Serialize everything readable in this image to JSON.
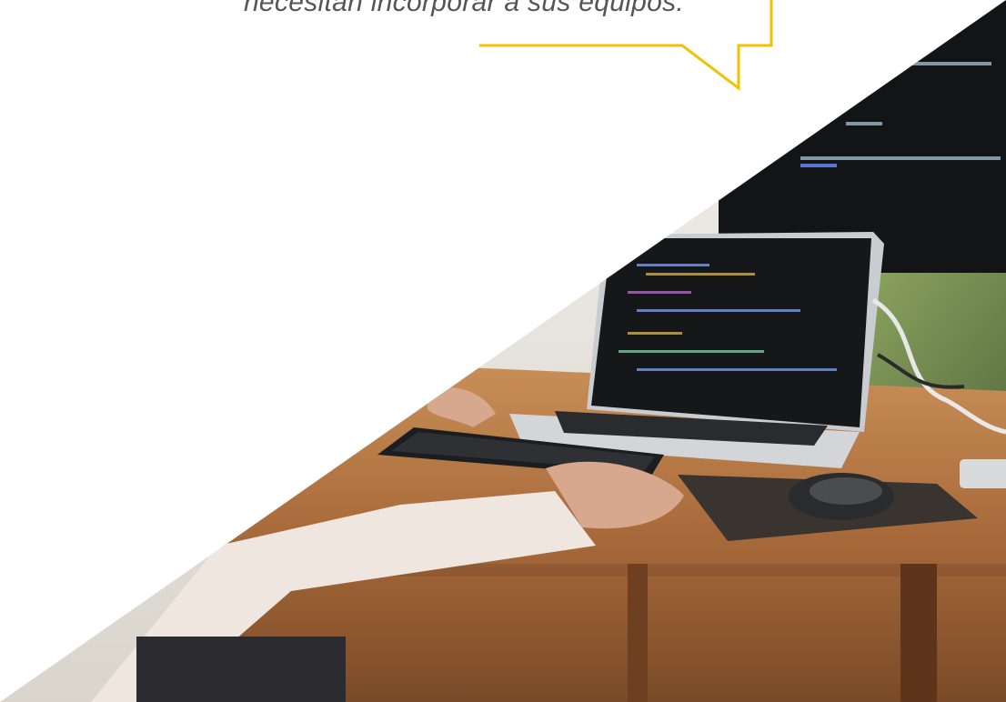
{
  "quote": {
    "text": "necesitan incorporar a sus equipos."
  },
  "colors": {
    "accent": "#f2c200",
    "text": "#555555",
    "background": "#ffffff"
  },
  "photo": {
    "icon": "developer-desk-photo"
  }
}
